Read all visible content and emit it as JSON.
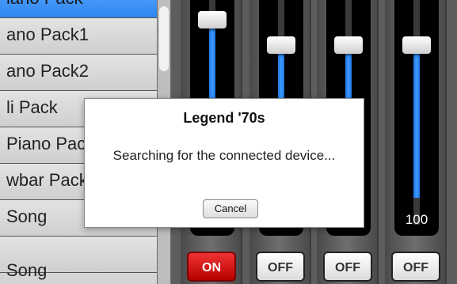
{
  "pack_list": {
    "items": [
      {
        "label": "iano Pack"
      },
      {
        "label": "ano Pack1"
      },
      {
        "label": "ano Pack2"
      },
      {
        "label": "li Pack"
      },
      {
        "label": "Piano Pack"
      },
      {
        "label": "wbar Pack"
      },
      {
        "label": "Song"
      },
      {
        "label": "Song"
      }
    ],
    "selected_index": 0,
    "selected_color": "#3d95ff"
  },
  "mixer": {
    "channels": [
      {
        "value": "100",
        "button": "ON",
        "button_state": "on",
        "level": 1.0
      },
      {
        "value": "100",
        "button": "OFF",
        "button_state": "off",
        "level": 1.0
      },
      {
        "value": "100",
        "button": "OFF",
        "button_state": "off",
        "level": 1.0
      },
      {
        "value": "100",
        "button": "OFF",
        "button_state": "off",
        "level": 1.0
      }
    ],
    "fill_color": "#2f86f0",
    "on_color": "#d11a1a"
  },
  "dialog": {
    "title": "Legend '70s",
    "message": "Searching for the connected device...",
    "cancel_label": "Cancel"
  }
}
